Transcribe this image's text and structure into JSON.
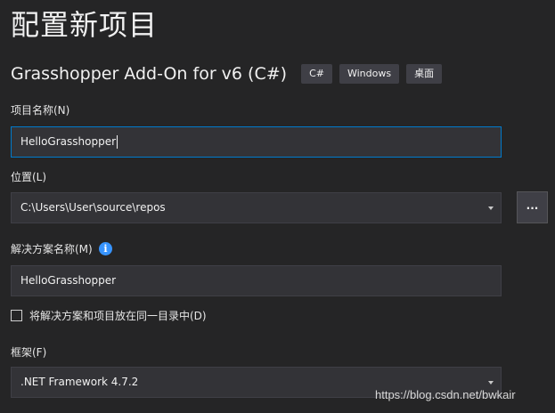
{
  "header": {
    "title": "配置新项目"
  },
  "template": {
    "name": "Grasshopper Add-On for v6 (C#)",
    "tags": [
      "C#",
      "Windows",
      "桌面"
    ]
  },
  "project_name": {
    "label": "项目名称(N)",
    "value": "HelloGrasshopper"
  },
  "location": {
    "label": "位置(L)",
    "value": "C:\\Users\\User\\source\\repos",
    "browse_label": "..."
  },
  "solution_name": {
    "label": "解决方案名称(M)",
    "value": "HelloGrasshopper",
    "info_glyph": "i"
  },
  "same_directory": {
    "label": "将解决方案和项目放在同一目录中(D)",
    "checked": false
  },
  "framework": {
    "label": "框架(F)",
    "value": ".NET Framework 4.7.2"
  },
  "watermark": "https://blog.csdn.net/bwkair",
  "colors": {
    "background": "#252526",
    "input_background": "#333337",
    "focus_border": "#007acc",
    "info_icon": "#3794ff"
  },
  "icons": {
    "dropdown": "chevron-down-icon",
    "info": "info-icon"
  }
}
